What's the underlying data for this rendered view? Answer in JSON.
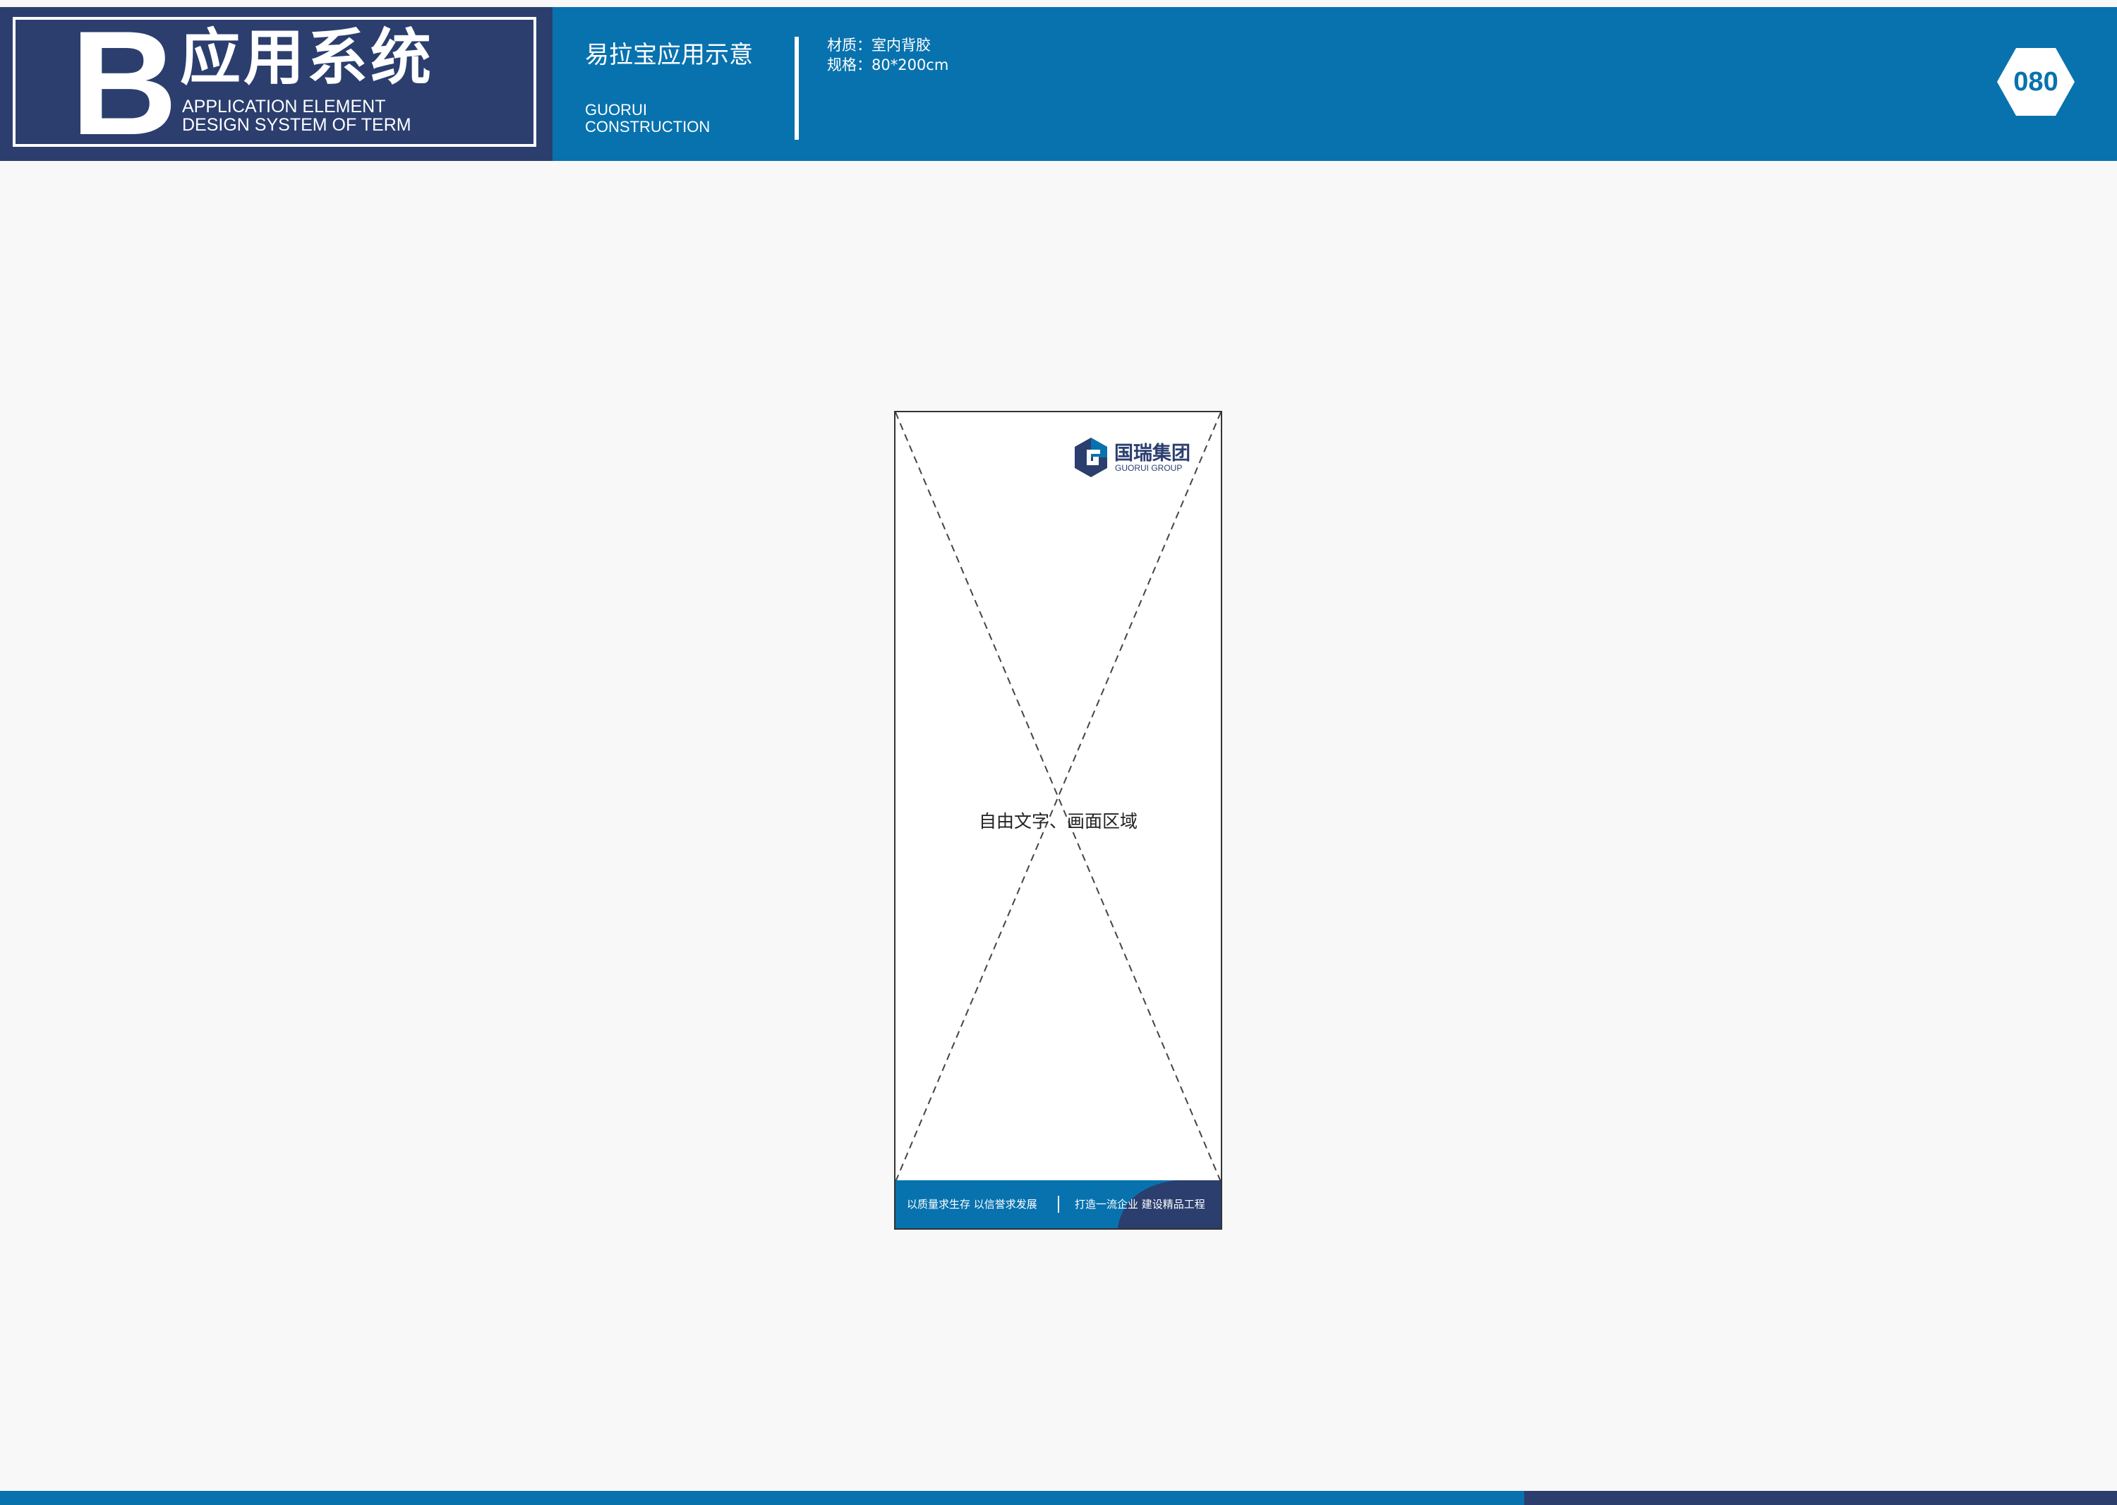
{
  "header": {
    "section_letter": "B",
    "section_name": "应用系统",
    "section_en_1": "APPLICATION ELEMENT",
    "section_en_2": "DESIGN SYSTEM OF TERM",
    "item_title": "易拉宝应用示意",
    "company_1": "GUORUI",
    "company_2": "CONSTRUCTION",
    "material": "材质：室内背胶",
    "spec": "规格：80*200cm",
    "page_number": "080"
  },
  "banner": {
    "logo_cn": "国瑞集团",
    "logo_en": "GUORUI GROUP",
    "center_text": "自由文字、画面区域",
    "slogan_left": "以质量求生存  以信誉求发展",
    "slogan_right": "打造一流企业  建设精品工程"
  },
  "colors": {
    "primary_blue": "#0872ae",
    "navy": "#2b3e6e",
    "page_background": "#f8f8f8"
  }
}
